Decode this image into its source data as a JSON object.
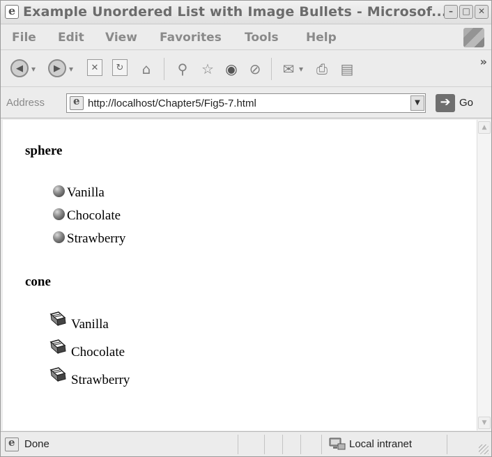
{
  "window": {
    "title": "Example Unordered List with Image Bullets - Microsof...",
    "minimize_glyph": "–",
    "maximize_glyph": "□",
    "close_glyph": "✕"
  },
  "menu": {
    "items": [
      "File",
      "Edit",
      "View",
      "Favorites",
      "Tools",
      "Help"
    ]
  },
  "toolbar": {
    "icons": [
      "back-icon",
      "forward-icon",
      "stop-icon",
      "refresh-icon",
      "home-icon",
      "search-icon",
      "favorites-icon",
      "media-icon",
      "history-icon",
      "mail-icon",
      "print-icon",
      "edit-icon"
    ],
    "more_glyph": "»"
  },
  "address": {
    "label": "Address",
    "url": "http://localhost/Chapter5/Fig5-7.html",
    "go_label": "Go"
  },
  "content": {
    "sphere": {
      "heading": "sphere",
      "items": [
        "Vanilla",
        "Chocolate",
        "Strawberry"
      ]
    },
    "cone": {
      "heading": "cone",
      "items": [
        "Vanilla",
        "Chocolate",
        "Strawberry"
      ]
    }
  },
  "status": {
    "text": "Done",
    "zone": "Local intranet"
  }
}
